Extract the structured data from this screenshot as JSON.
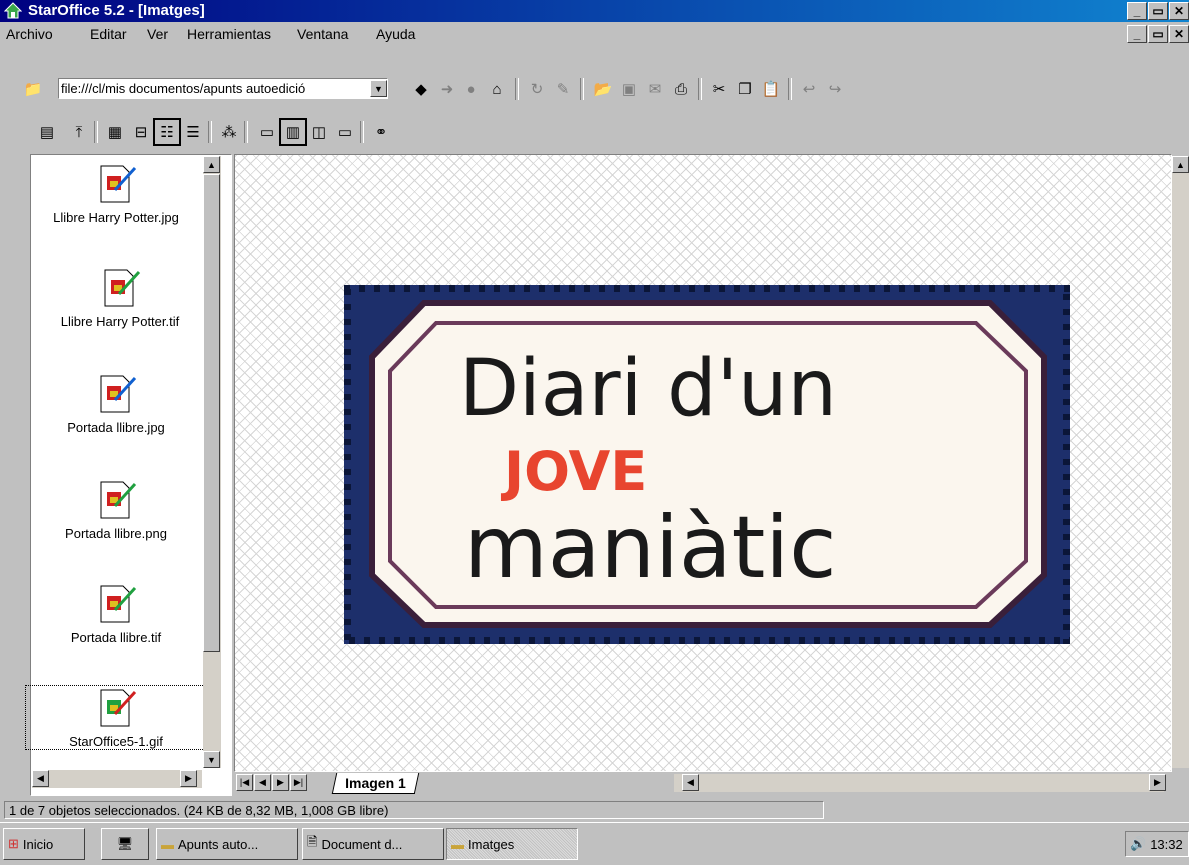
{
  "window": {
    "title": "StarOffice 5.2 - [Imatges]"
  },
  "menu": [
    "Archivo",
    "Editar",
    "Ver",
    "Herramientas",
    "Ventana",
    "Ayuda"
  ],
  "url": {
    "value": "file:///cl/mis documentos/apunts autoedició"
  },
  "files": [
    "Llibre Harry Potter.jpg",
    "Llibre Harry Potter.tif",
    "Portada llibre.jpg",
    "Portada llibre.png",
    "Portada llibre.tif",
    "StarOffice5-1.gif"
  ],
  "image": {
    "line1": "Diari d'un",
    "line2": "JOVE",
    "line3": "maniàtic",
    "accent": "#e8452f",
    "frame": "#1d2f6b"
  },
  "sheet_tab": "Imagen 1",
  "status": "1 de 7 objetos seleccionados. (24 KB de 8,32 MB, 1,008 GB libre)",
  "taskbar": {
    "start": "Inicio",
    "tasks": [
      "Apunts auto...",
      "Document d...",
      "Imatges"
    ],
    "clock": "13:32"
  }
}
